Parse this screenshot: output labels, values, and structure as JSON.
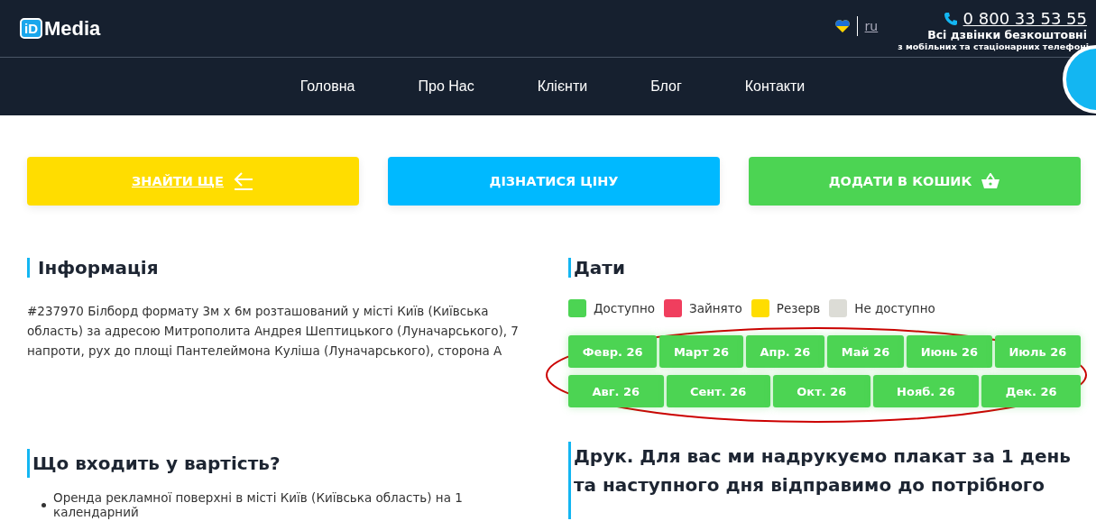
{
  "header": {
    "logo_mark": "iD",
    "logo_text": "Media",
    "language": "ru",
    "phone": "0 800 33 53 55",
    "phone_note": "Всі дзвінки безкоштовні",
    "phone_subnote": "з мобільних та стаціонарних телефоні"
  },
  "nav": [
    "Головна",
    "Про Нас",
    "Клієнти",
    "Блог",
    "Контакти"
  ],
  "actions": [
    {
      "label": "ЗНАЙТИ ЩЕ",
      "kind": "back"
    },
    {
      "label": "ДІЗНАТИСЯ ЦІНУ",
      "kind": "price"
    },
    {
      "label": "ДОДАТИ В КОШИК",
      "kind": "cart"
    }
  ],
  "info": {
    "title": "Інформація",
    "text": "#237970 Білборд формату 3м х 6м розташований у місті Київ (Київська область) за адресою Митрополита Андрея Шептицького (Луначарського), 7 напроти, рух до площі Пантелеймона Куліша (Луначарського), сторона А"
  },
  "dates": {
    "title": "Дати",
    "legend": [
      {
        "label": "Доступно",
        "color": "#4cd453"
      },
      {
        "label": "Зайнято",
        "color": "#f03e5e"
      },
      {
        "label": "Резерв",
        "color": "#ffdd00"
      },
      {
        "label": "Не доступно",
        "color": "#dcdcd6"
      }
    ],
    "months": [
      {
        "label": "Февр. 26",
        "color": "#4cd453"
      },
      {
        "label": "Март 26",
        "color": "#4cd453"
      },
      {
        "label": "Апр. 26",
        "color": "#4cd453"
      },
      {
        "label": "Май 26",
        "color": "#4cd453"
      },
      {
        "label": "Июнь 26",
        "color": "#4cd453"
      },
      {
        "label": "Июль 26",
        "color": "#4cd453"
      },
      {
        "label": "Авг. 26",
        "color": "#4cd453"
      },
      {
        "label": "Сент. 26",
        "color": "#4cd453"
      },
      {
        "label": "Окт. 26",
        "color": "#4cd453"
      },
      {
        "label": "Нояб. 26",
        "color": "#4cd453"
      },
      {
        "label": "Дек. 26",
        "color": "#4cd453"
      }
    ],
    "highlight": {
      "kind": "ellipse"
    }
  },
  "included": {
    "title": "Що входить у вартість?",
    "items": [
      "Оренда рекламної поверхні в місті Київ (Київська область) на 1 календарний"
    ]
  },
  "print": {
    "title": "Друк. Для вас ми надрукуємо плакат за 1 день та наступного дня відправимо до потрібного"
  }
}
